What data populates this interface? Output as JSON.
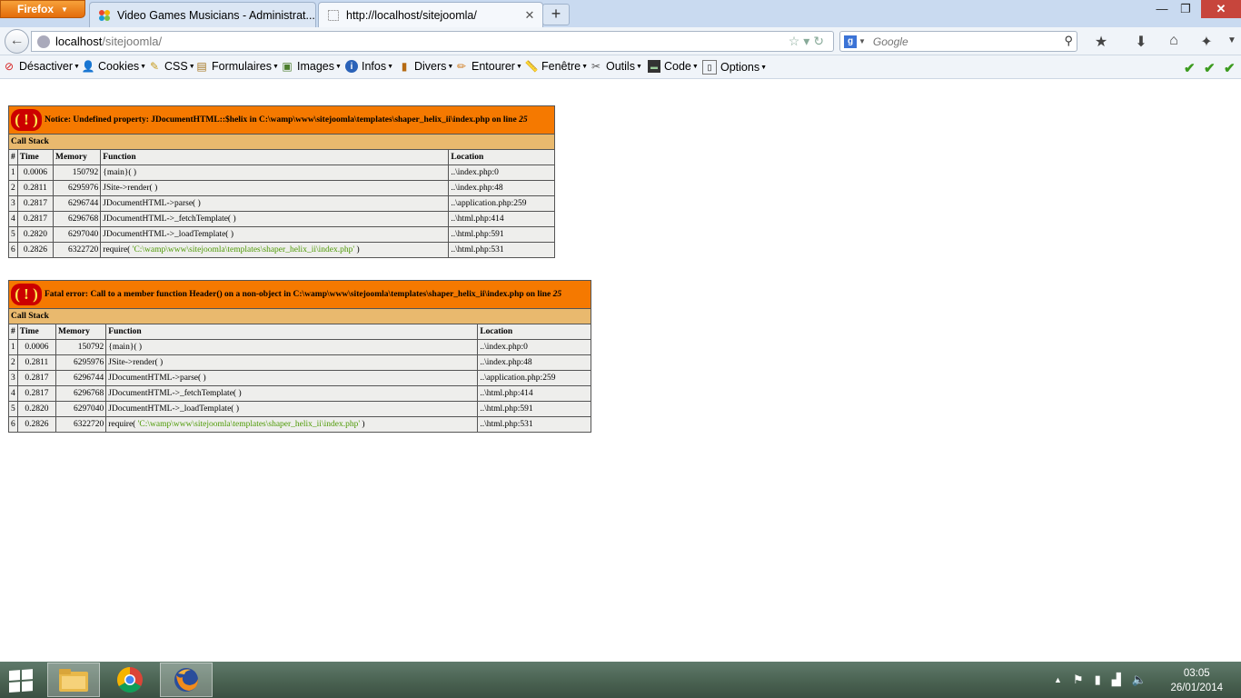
{
  "browser": {
    "app_button": "Firefox",
    "tabs": [
      {
        "title": "Video Games Musicians - Administrat..."
      },
      {
        "title": "http://localhost/sitejoomla/"
      }
    ],
    "url_host": "localhost",
    "url_path": "/sitejoomla/",
    "search_placeholder": "Google"
  },
  "devbar": {
    "items": [
      "Désactiver",
      "Cookies",
      "CSS",
      "Formulaires",
      "Images",
      "Infos",
      "Divers",
      "Entourer",
      "Fenêtre",
      "Outils",
      "Code",
      "Options"
    ]
  },
  "errors": [
    {
      "message": "Notice: Undefined property: JDocumentHTML::$helix in C:\\wamp\\www\\sitejoomla\\templates\\shaper_helix_ii\\index.php on line ",
      "line": "25",
      "call_stack_label": "Call Stack",
      "columns": [
        "#",
        "Time",
        "Memory",
        "Function",
        "Location"
      ],
      "rows": [
        {
          "n": "1",
          "time": "0.0006",
          "memory": "150792",
          "func": "{main}( )",
          "loc": "..\\index.php:0"
        },
        {
          "n": "2",
          "time": "0.2811",
          "memory": "6295976",
          "func": "JSite->render( )",
          "loc": "..\\index.php:48"
        },
        {
          "n": "3",
          "time": "0.2817",
          "memory": "6296744",
          "func": "JDocumentHTML->parse( )",
          "loc": "..\\application.php:259"
        },
        {
          "n": "4",
          "time": "0.2817",
          "memory": "6296768",
          "func": "JDocumentHTML->_fetchTemplate( )",
          "loc": "..\\html.php:414"
        },
        {
          "n": "5",
          "time": "0.2820",
          "memory": "6297040",
          "func": "JDocumentHTML->_loadTemplate( )",
          "loc": "..\\html.php:591"
        },
        {
          "n": "6",
          "time": "0.2826",
          "memory": "6322720",
          "func_pre": "require( ",
          "func_str": "'C:\\wamp\\www\\sitejoomla\\templates\\shaper_helix_ii\\index.php'",
          "func_post": " )",
          "loc": "..\\html.php:531"
        }
      ]
    },
    {
      "message": "Fatal error: Call to a member function Header() on a non-object in C:\\wamp\\www\\sitejoomla\\templates\\shaper_helix_ii\\index.php on line ",
      "line": "25",
      "call_stack_label": "Call Stack",
      "columns": [
        "#",
        "Time",
        "Memory",
        "Function",
        "Location"
      ],
      "rows": [
        {
          "n": "1",
          "time": "0.0006",
          "memory": "150792",
          "func": "{main}( )",
          "loc": "..\\index.php:0"
        },
        {
          "n": "2",
          "time": "0.2811",
          "memory": "6295976",
          "func": "JSite->render( )",
          "loc": "..\\index.php:48"
        },
        {
          "n": "3",
          "time": "0.2817",
          "memory": "6296744",
          "func": "JDocumentHTML->parse( )",
          "loc": "..\\application.php:259"
        },
        {
          "n": "4",
          "time": "0.2817",
          "memory": "6296768",
          "func": "JDocumentHTML->_fetchTemplate( )",
          "loc": "..\\html.php:414"
        },
        {
          "n": "5",
          "time": "0.2820",
          "memory": "6297040",
          "func": "JDocumentHTML->_loadTemplate( )",
          "loc": "..\\html.php:591"
        },
        {
          "n": "6",
          "time": "0.2826",
          "memory": "6322720",
          "func_pre": "require( ",
          "func_str": "'C:\\wamp\\www\\sitejoomla\\templates\\shaper_helix_ii\\index.php'",
          "func_post": " )",
          "loc": "..\\html.php:531"
        }
      ]
    }
  ],
  "taskbar": {
    "time": "03:05",
    "date": "26/01/2014"
  }
}
